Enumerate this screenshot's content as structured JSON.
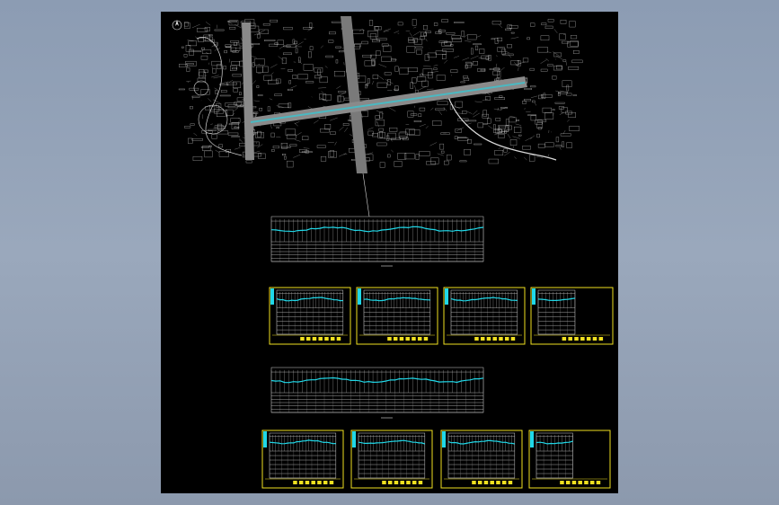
{
  "viewer": {
    "background_top": "#8c9cb3",
    "background_bottom": "#8c99ad",
    "canvas_color": "#000000"
  },
  "drawing": {
    "main_profile_count": 2,
    "sheets_per_row": 4,
    "sheet_frame_color": "#f0e020",
    "linework_color": "#d8d8d8",
    "road_color": "#8a8a8a",
    "profile_line_color": "#20d8e8"
  }
}
